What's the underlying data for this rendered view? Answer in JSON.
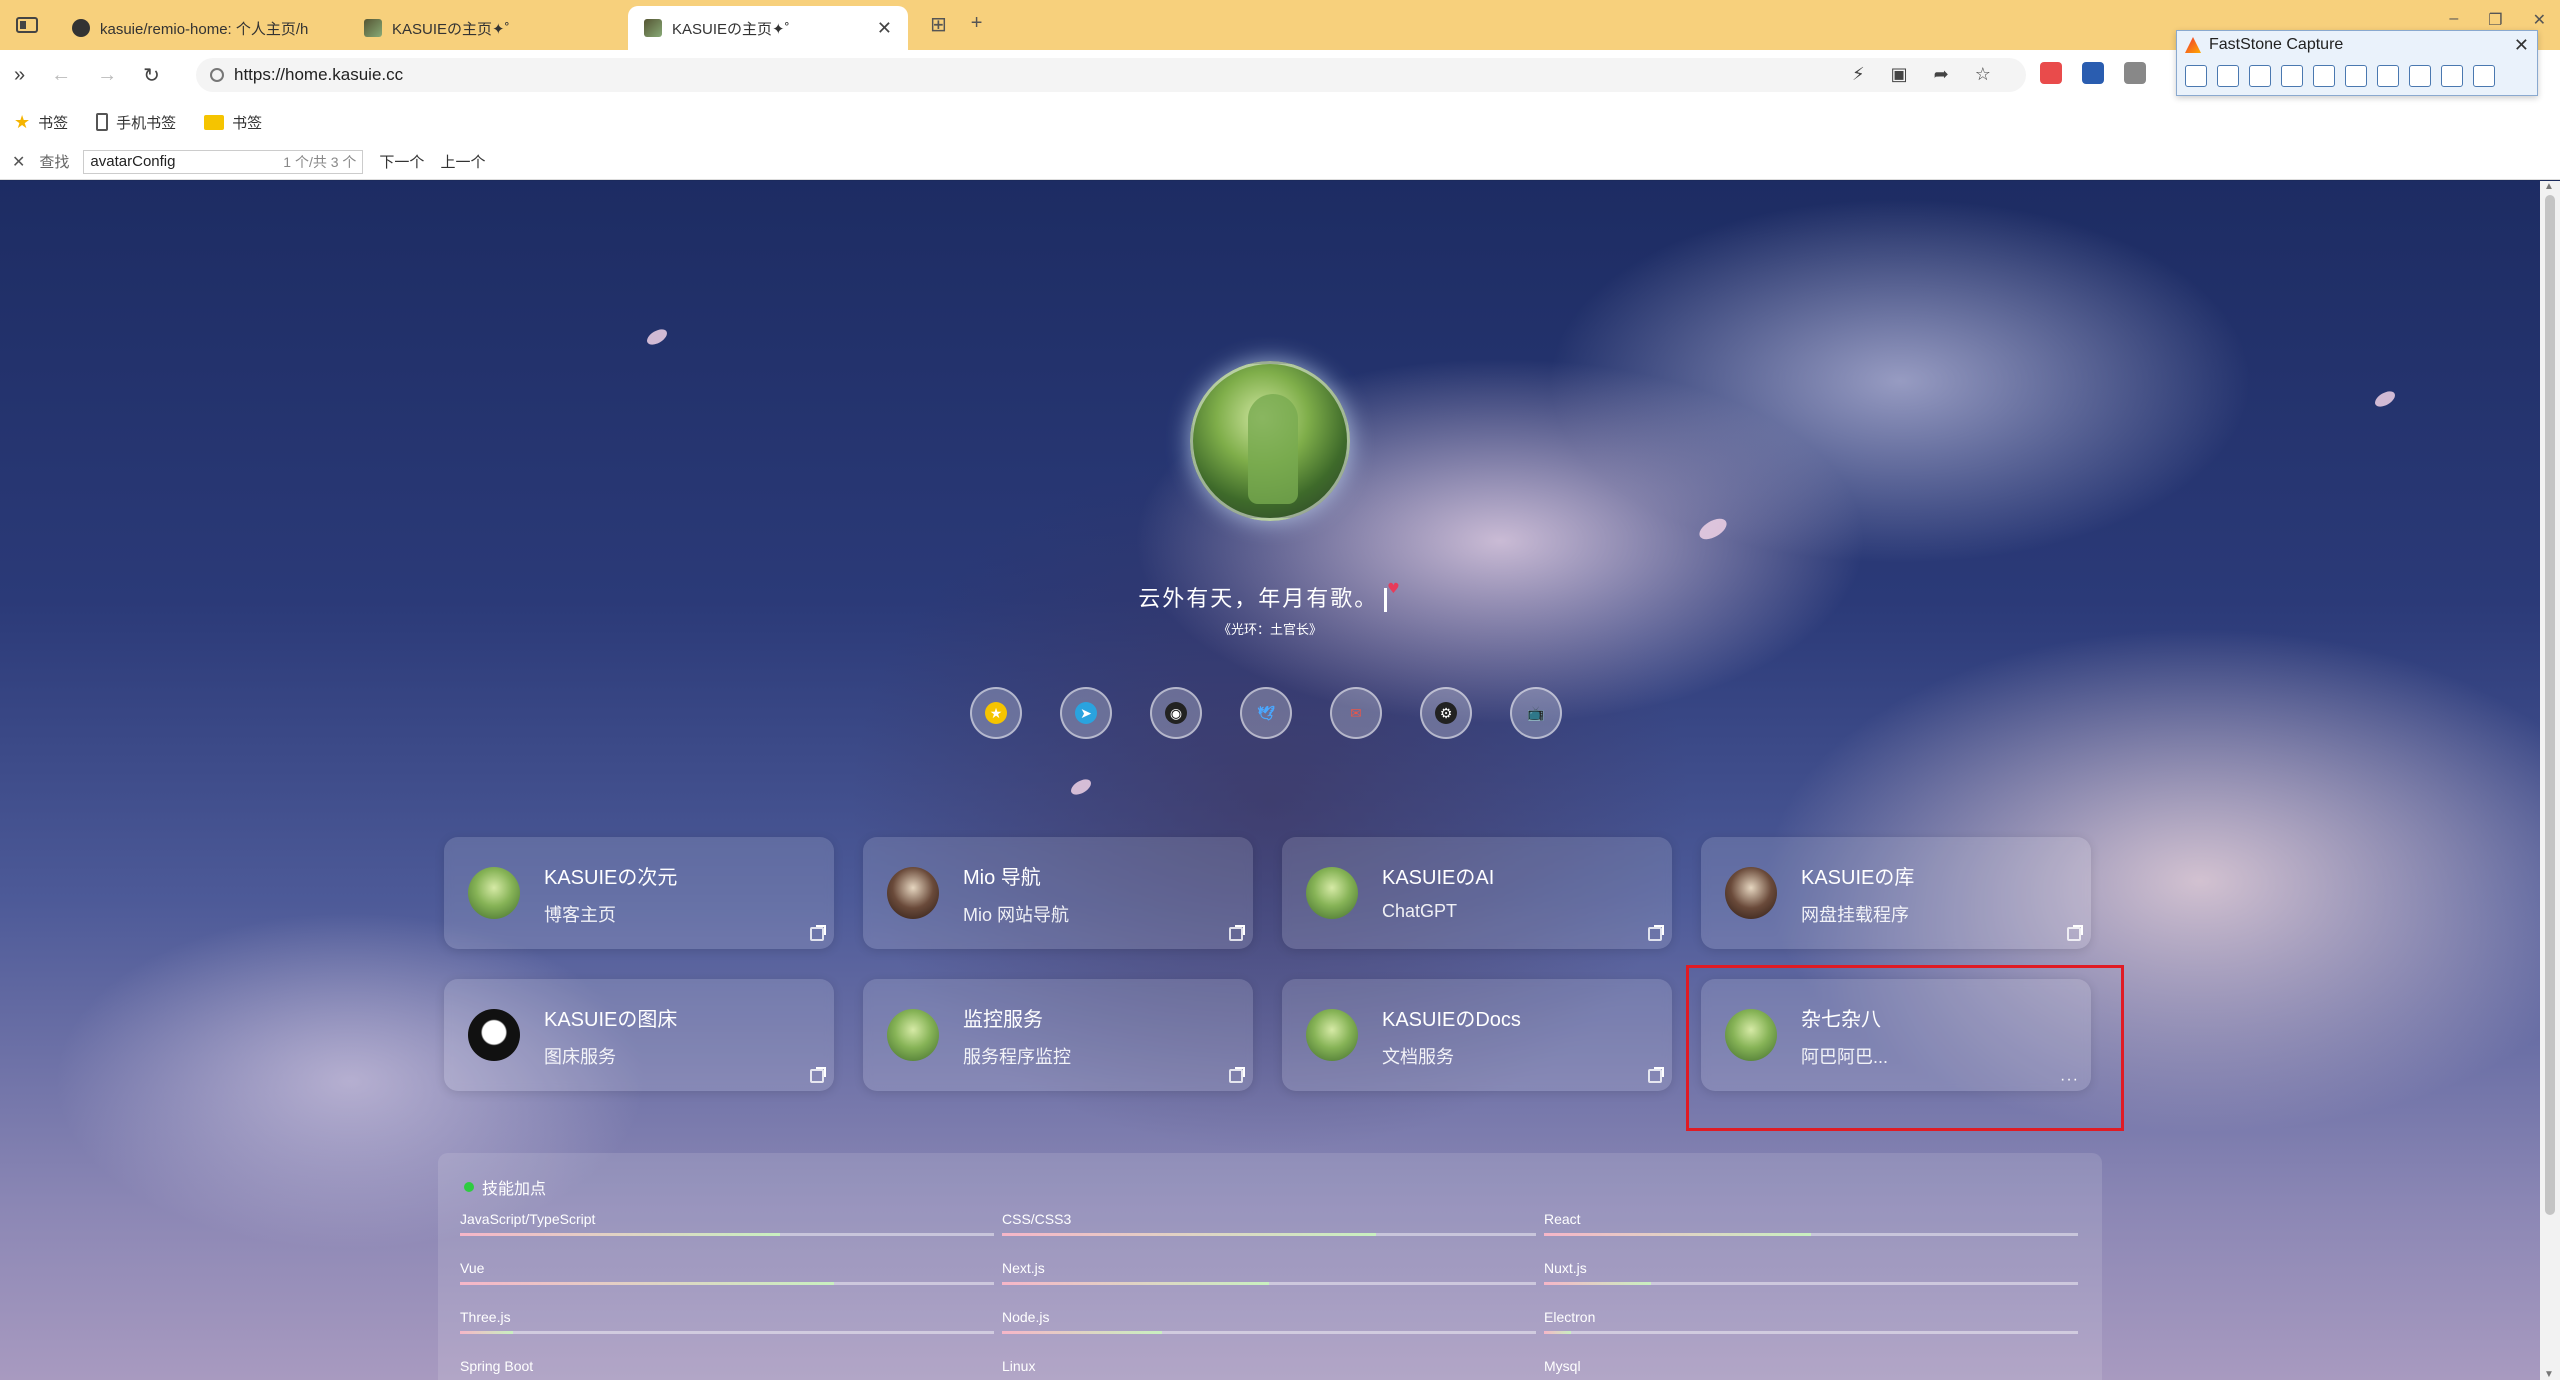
{
  "browser": {
    "tabs": [
      {
        "title": "kasuie/remio-home: 个人主页/h",
        "active": false
      },
      {
        "title": "KASUIEの主页✦˚",
        "active": false
      },
      {
        "title": "KASUIEの主页✦˚",
        "active": true
      }
    ],
    "url": "https://home.kasuie.cc",
    "bookmarks": [
      "书签",
      "手机书签",
      "书签"
    ],
    "find": {
      "label": "查找",
      "value": "avatarConfig",
      "count": "1 个/共 3 个",
      "next": "下一个",
      "prev": "上一个"
    }
  },
  "faststone": {
    "title": "FastStone Capture"
  },
  "profile": {
    "motto": "云外有天，年月有歌。",
    "source": "《光环：土官长》"
  },
  "socials": [
    {
      "name": "star",
      "color": "#f5c400"
    },
    {
      "name": "telegram",
      "color": "#2aa3df"
    },
    {
      "name": "github",
      "color": "#222222"
    },
    {
      "name": "twitter",
      "color": "#4aa8ff"
    },
    {
      "name": "email",
      "color": "#e8564a"
    },
    {
      "name": "steam",
      "color": "#222222"
    },
    {
      "name": "bilibili",
      "color": "#2aa3df"
    }
  ],
  "cards": [
    {
      "title": "KASUIEの次元",
      "desc": "博客主页",
      "avatar": "green",
      "action": "external"
    },
    {
      "title": "Mio 导航",
      "desc": "Mio 网站导航",
      "avatar": "dark",
      "action": "external"
    },
    {
      "title": "KASUIEのAI",
      "desc": "ChatGPT",
      "avatar": "green",
      "action": "external"
    },
    {
      "title": "KASUIEの库",
      "desc": "网盘挂载程序",
      "avatar": "dark",
      "action": "external"
    },
    {
      "title": "KASUIEの图床",
      "desc": "图床服务",
      "avatar": "ink",
      "action": "external"
    },
    {
      "title": "监控服务",
      "desc": "服务程序监控",
      "avatar": "green",
      "action": "external"
    },
    {
      "title": "KASUIEのDocs",
      "desc": "文档服务",
      "avatar": "green",
      "action": "external"
    },
    {
      "title": "杂七杂八",
      "desc": "阿巴阿巴...",
      "avatar": "green",
      "action": "more"
    }
  ],
  "skills": {
    "title": "技能加点",
    "items": [
      {
        "name": "JavaScript/TypeScript",
        "level": 0.6
      },
      {
        "name": "CSS/CSS3",
        "level": 0.7
      },
      {
        "name": "React",
        "level": 0.5
      },
      {
        "name": "Vue",
        "level": 0.7
      },
      {
        "name": "Next.js",
        "level": 0.5
      },
      {
        "name": "Nuxt.js",
        "level": 0.2
      },
      {
        "name": "Three.js",
        "level": 0.1
      },
      {
        "name": "Node.js",
        "level": 0.3
      },
      {
        "name": "Electron",
        "level": 0.05
      },
      {
        "name": "Spring Boot",
        "level": 0
      },
      {
        "name": "Linux",
        "level": 0
      },
      {
        "name": "Mysql",
        "level": 0
      }
    ]
  }
}
